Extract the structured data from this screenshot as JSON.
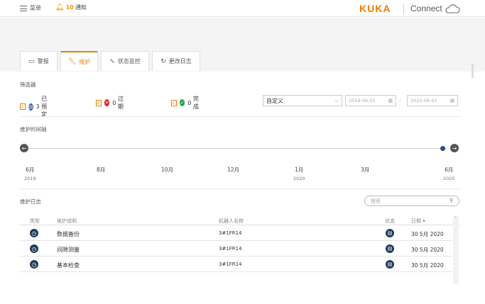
{
  "topbar": {
    "menu": "菜单",
    "notif_count": "10",
    "notif_label": "通知",
    "brand": "KUKA",
    "connect": "Connect"
  },
  "tabs": [
    {
      "label": "警报",
      "icon": "alarm-icon"
    },
    {
      "label": "维护",
      "icon": "wrench-icon"
    },
    {
      "label": "状态监控",
      "icon": "wave-icon"
    },
    {
      "label": "更改日志",
      "icon": "history-icon"
    }
  ],
  "filters": {
    "title": "筛选器",
    "scheduled": {
      "count": "3",
      "label": "已预定"
    },
    "overdue": {
      "count": "0",
      "label": "过期"
    },
    "done": {
      "count": "0",
      "label": "完成"
    },
    "period": "自定义",
    "date_from": "2019-06-01",
    "date_to": "2020-06-01",
    "dash": "-"
  },
  "timeline": {
    "title": "维护时间轴",
    "months": [
      {
        "m": "6月",
        "y": "2019"
      },
      {
        "m": "8月",
        "y": ""
      },
      {
        "m": "10月",
        "y": ""
      },
      {
        "m": "12月",
        "y": ""
      },
      {
        "m": "1月",
        "y": "2020"
      },
      {
        "m": "3月",
        "y": ""
      },
      {
        "m": "6月",
        "y": "2020"
      }
    ]
  },
  "log": {
    "title": "维护日志",
    "search_placeholder": "搜索",
    "headers": {
      "type": "类型",
      "desc": "维护说明",
      "robot": "机器人名称",
      "status": "状态",
      "date": "日期 ▾"
    },
    "rows": [
      {
        "desc": "数据备份",
        "robot": "3#1FR14",
        "date": "30 5月 2020"
      },
      {
        "desc": "间隙测量",
        "robot": "3#1FR14",
        "date": "30 5月 2020"
      },
      {
        "desc": "基本检查",
        "robot": "3#1FR14",
        "date": "30 5月 2020"
      }
    ]
  },
  "colors": {
    "accent": "#f07d00",
    "navy": "#1f3a5f",
    "green": "#2e9e4f",
    "red": "#d9232e"
  }
}
